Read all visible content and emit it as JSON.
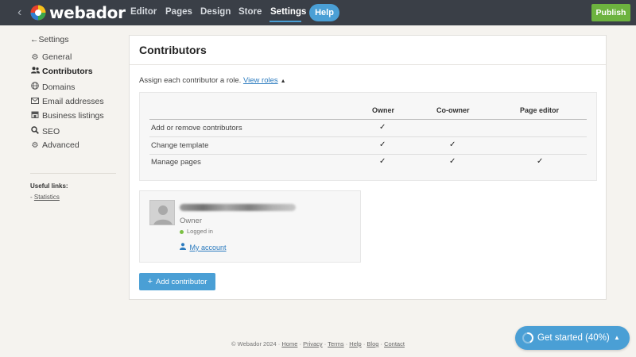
{
  "topbar": {
    "brand": "webador",
    "nav": [
      {
        "label": "Editor"
      },
      {
        "label": "Pages"
      },
      {
        "label": "Design"
      },
      {
        "label": "Store"
      },
      {
        "label": "Settings"
      }
    ],
    "help_label": "Help",
    "publish_label": "Publish",
    "colors": {
      "bar": "#3a3f47",
      "accent": "#4a9fd5",
      "publish": "#6db33f"
    }
  },
  "sidebar": {
    "back_label": "Settings",
    "items": [
      {
        "label": "General",
        "icon": "gear-icon"
      },
      {
        "label": "Contributors",
        "icon": "users-icon",
        "active": true
      },
      {
        "label": "Domains",
        "icon": "globe-icon"
      },
      {
        "label": "Email addresses",
        "icon": "envelope-icon"
      },
      {
        "label": "Business listings",
        "icon": "store-icon"
      },
      {
        "label": "SEO",
        "icon": "search-icon"
      },
      {
        "label": "Advanced",
        "icon": "gears-icon"
      }
    ],
    "useful_links_title": "Useful links:",
    "useful_links": [
      {
        "label": "Statistics"
      }
    ]
  },
  "main": {
    "title": "Contributors",
    "assign_text": "Assign each contributor a role.",
    "view_roles_label": "View roles",
    "roles": {
      "columns": [
        "Owner",
        "Co-owner",
        "Page editor"
      ],
      "rows": [
        {
          "label": "Add or remove contributors",
          "owner": "✓",
          "co_owner": "",
          "page_editor": ""
        },
        {
          "label": "Change template",
          "owner": "✓",
          "co_owner": "✓",
          "page_editor": ""
        },
        {
          "label": "Manage pages",
          "owner": "✓",
          "co_owner": "✓",
          "page_editor": "✓"
        }
      ]
    },
    "contributor": {
      "role": "Owner",
      "status": "Logged in",
      "account_label": "My account"
    },
    "add_contributor_label": "Add contributor"
  },
  "footer": {
    "copyright": "© Webador 2024",
    "links": [
      {
        "label": "Home"
      },
      {
        "label": "Privacy"
      },
      {
        "label": "Terms"
      },
      {
        "label": "Help"
      },
      {
        "label": "Blog"
      },
      {
        "label": "Contact"
      }
    ]
  },
  "get_started": {
    "label": "Get started (40%)",
    "progress": 0.4
  }
}
